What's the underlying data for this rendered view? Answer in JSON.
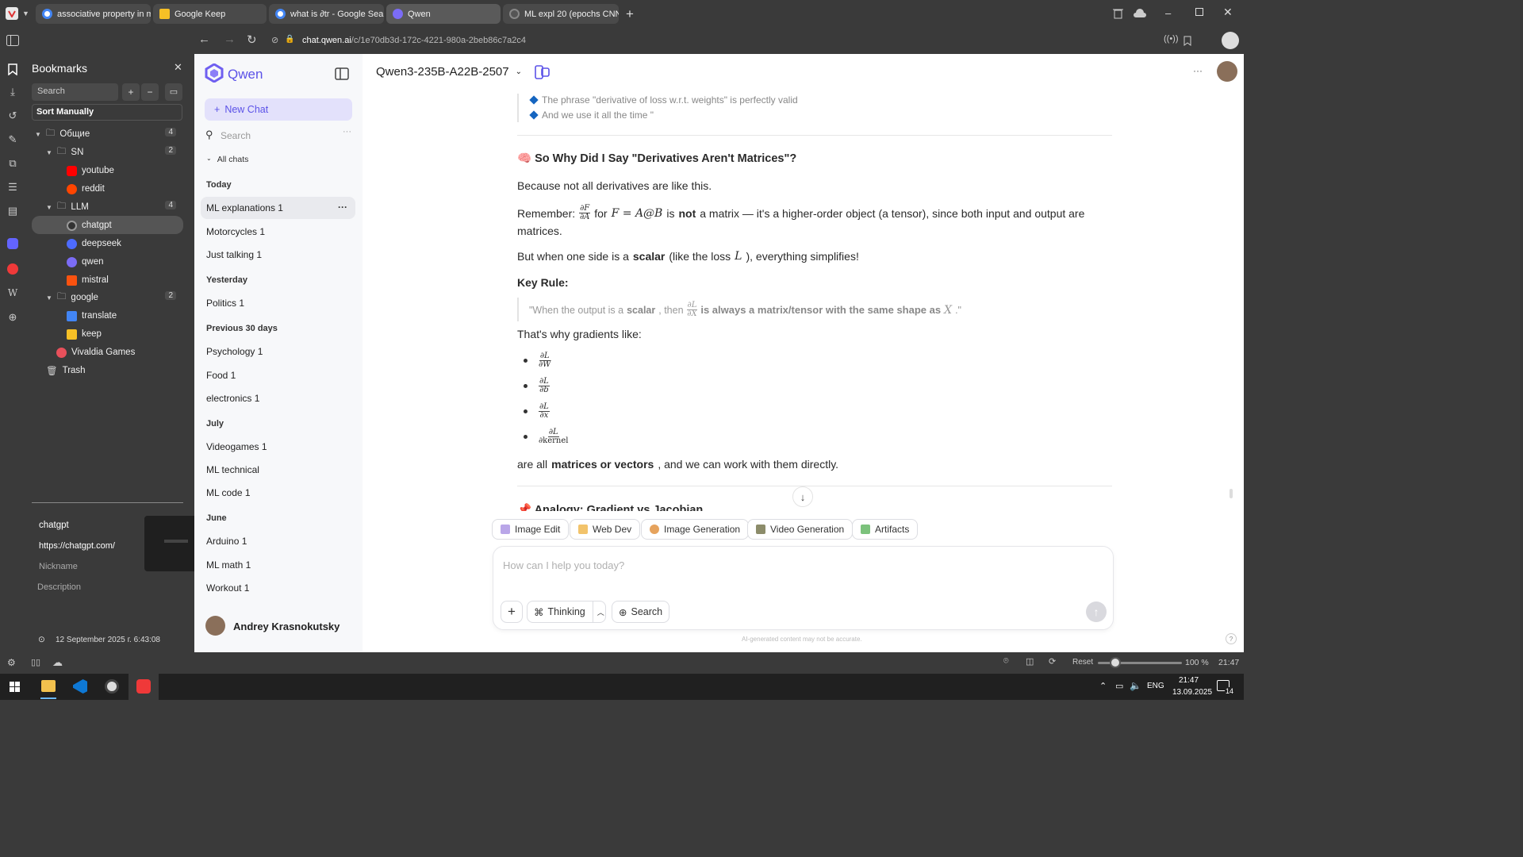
{
  "tabs": [
    {
      "title": "associative property in mul",
      "color": "#ffffff"
    },
    {
      "title": "Google Keep",
      "color": "#f6c026"
    },
    {
      "title": "what is ∂tr - Google Search",
      "color": "#ffffff"
    },
    {
      "title": "Qwen",
      "color": "#7b6cf6"
    },
    {
      "title": "ML expl 20 (epochs CNN)",
      "color": "#555555"
    }
  ],
  "address": {
    "domain": "chat.qwen.ai",
    "path": "/c/1e70db3d-172c-4221-980a-2beb86c7a2c4"
  },
  "bookmarks": {
    "title": "Bookmarks",
    "search_placeholder": "Search",
    "sort": "Sort Manually",
    "tree": [
      {
        "label": "Общие",
        "count": "4"
      },
      {
        "label": "SN",
        "count": "2"
      },
      {
        "label": "youtube"
      },
      {
        "label": "reddit"
      },
      {
        "label": "LLM",
        "count": "4"
      },
      {
        "label": "chatgpt"
      },
      {
        "label": "deepseek"
      },
      {
        "label": "qwen"
      },
      {
        "label": "mistral"
      },
      {
        "label": "google",
        "count": "2"
      },
      {
        "label": "translate"
      },
      {
        "label": "keep"
      },
      {
        "label": "Vivaldia Games"
      },
      {
        "label": "Trash"
      }
    ],
    "details": {
      "name": "chatgpt",
      "url": "https://chatgpt.com/",
      "nickname": "Nickname",
      "description": "Description",
      "date": "12 September 2025 г. 6:43:08"
    }
  },
  "qwen": {
    "logo": "Qwen",
    "new_chat": "New Chat",
    "search_placeholder": "Search",
    "all_chats": "All chats",
    "sections": [
      {
        "title": "Today",
        "chats": [
          "ML explanations 1",
          "Motorcycles 1",
          "Just talking 1"
        ]
      },
      {
        "title": "Yesterday",
        "chats": [
          "Politics 1"
        ]
      },
      {
        "title": "Previous 30 days",
        "chats": [
          "Psychology 1",
          "Food 1",
          "electronics 1"
        ]
      },
      {
        "title": "July",
        "chats": [
          "Videogames 1",
          "ML technical",
          "ML code 1"
        ]
      },
      {
        "title": "June",
        "chats": [
          "Arduino 1",
          "ML math 1",
          "Workout 1"
        ]
      }
    ],
    "user": "Andrey Krasnokutsky"
  },
  "main": {
    "model": "Qwen3-235B-A22B-2507",
    "bullet1": "The phrase \"derivative of loss w.r.t. weights\" is perfectly valid",
    "bullet2": "And we use it all the time \"",
    "heading": "So Why Did I Say \"Derivatives Aren't Matrices\"?",
    "heading_emoji": "🧠",
    "p1": "Because not all derivatives are like this.",
    "p2_a": "Remember:",
    "p2_b": "for",
    "p2_c": "is",
    "p2_not": "not",
    "p2_d": "a matrix — it's a higher-order object (a tensor), since both input and output are",
    "p2_e": "matrices.",
    "p3_a": "But when one side is a",
    "p3_scalar": "scalar",
    "p3_b": "(like the loss",
    "p3_c": "), everything simplifies!",
    "key_rule": "Key Rule:",
    "quote_a": "\"When the output is a",
    "quote_scalar": "scalar",
    "quote_b": ", then",
    "quote_c": "is always a matrix/tensor with the same shape as",
    "quote_d": ".\"",
    "p4": "That's why gradients like:",
    "fracs": [
      {
        "num": "∂L",
        "den": "∂W"
      },
      {
        "num": "∂L",
        "den": "∂b"
      },
      {
        "num": "∂L",
        "den": "∂x"
      },
      {
        "num": "∂L",
        "den": "∂kernel"
      }
    ],
    "p5_a": "are all",
    "p5_bold": "matrices or vectors",
    "p5_b": ", and we can work with them directly.",
    "next_heading": "Analogy: Gradient vs Jacobian",
    "next_emoji": "📌",
    "chips": [
      "Image Edit",
      "Web Dev",
      "Image Generation",
      "Video Generation",
      "Artifacts"
    ],
    "input_placeholder": "How can I help you today?",
    "thinking": "Thinking",
    "search": "Search",
    "disclaimer": "AI-generated content may not be accurate.",
    "help": "?"
  },
  "status": {
    "reset": "Reset",
    "zoom": "100 %",
    "time": "21:47"
  },
  "taskbar": {
    "lang": "ENG",
    "time": "21:47",
    "date": "13.09.2025",
    "notifications": "14"
  }
}
